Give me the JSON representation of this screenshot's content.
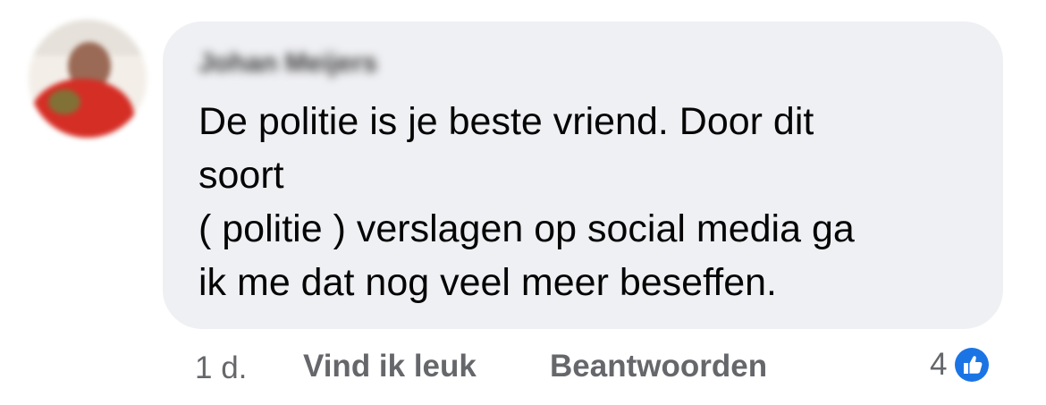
{
  "comment": {
    "author": "Johan Meijers",
    "text_lines": [
      "De politie is je beste vriend. Door dit",
      "soort",
      "( politie ) verslagen op social media ga",
      "ik me dat nog veel meer beseffen."
    ]
  },
  "actions": {
    "timestamp": "1 d.",
    "like_label": "Vind ik leuk",
    "reply_label": "Beantwoorden",
    "reaction_count": "4",
    "reaction_icon": "thumbs-up-icon"
  },
  "colors": {
    "bubble_background": "#eff0f3",
    "text": "#050505",
    "secondary_text": "#65676b",
    "like_blue": "#1b74e4"
  }
}
